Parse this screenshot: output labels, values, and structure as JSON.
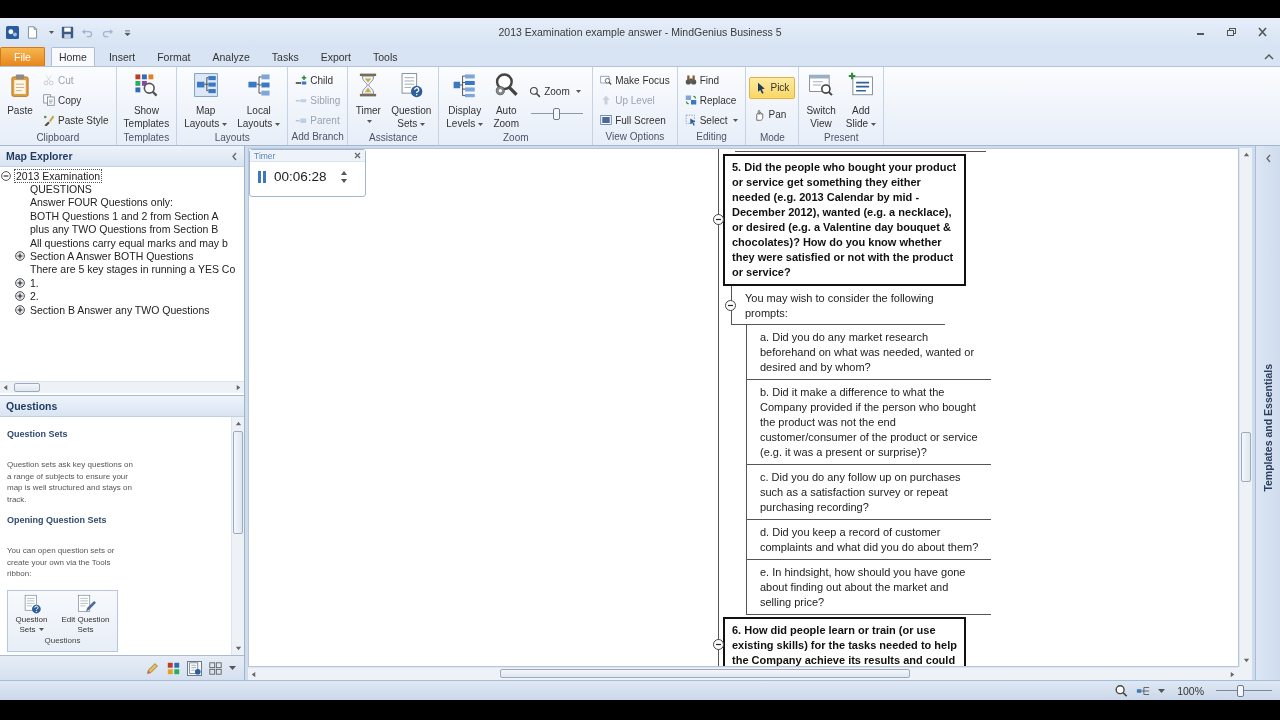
{
  "window": {
    "title": "2013 Examination example answer - MindGenius Business 5"
  },
  "quick_access": [
    {
      "kind": "new",
      "dropdown": true,
      "disabled": false
    },
    {
      "kind": "save",
      "dropdown": false,
      "disabled": false
    },
    {
      "kind": "undo",
      "dropdown": false,
      "disabled": true
    },
    {
      "kind": "redo",
      "dropdown": false,
      "disabled": true
    }
  ],
  "ribbon_tabs": [
    {
      "label": "File",
      "kind": "file",
      "selected": false
    },
    {
      "label": "Home",
      "kind": "tab",
      "selected": true
    },
    {
      "label": "Insert",
      "kind": "tab",
      "selected": false
    },
    {
      "label": "Format",
      "kind": "tab",
      "selected": false
    },
    {
      "label": "Analyze",
      "kind": "tab",
      "selected": false
    },
    {
      "label": "Tasks",
      "kind": "tab",
      "selected": false
    },
    {
      "label": "Export",
      "kind": "tab",
      "selected": false
    },
    {
      "label": "Tools",
      "kind": "tab",
      "selected": false
    }
  ],
  "ribbon_groups": [
    {
      "label": "Clipboard",
      "buttons": [
        {
          "kind": "large",
          "label": "Paste",
          "dropdown": false,
          "disabled": false
        },
        {
          "kind": "small",
          "label": "Cut",
          "dropdown": false,
          "disabled": true
        },
        {
          "kind": "small",
          "label": "Copy",
          "dropdown": false,
          "disabled": false
        },
        {
          "kind": "small",
          "label": "Paste Style",
          "dropdown": false,
          "disabled": false
        }
      ]
    },
    {
      "label": "Templates",
      "buttons": [
        {
          "kind": "large",
          "label": "Show Templates",
          "dropdown": false,
          "disabled": false
        }
      ]
    },
    {
      "label": "Layouts",
      "buttons": [
        {
          "kind": "large",
          "label": "Map Layouts",
          "dropdown": true,
          "disabled": false
        },
        {
          "kind": "large",
          "label": "Local Layouts",
          "dropdown": true,
          "disabled": false
        }
      ]
    },
    {
      "label": "Add Branch",
      "buttons": [
        {
          "kind": "small",
          "label": "Child",
          "dropdown": false,
          "disabled": false
        },
        {
          "kind": "small",
          "label": "Sibling",
          "dropdown": false,
          "disabled": true
        },
        {
          "kind": "small",
          "label": "Parent",
          "dropdown": false,
          "disabled": true
        }
      ]
    },
    {
      "label": "Assistance",
      "buttons": [
        {
          "kind": "large",
          "label": "Timer",
          "dropdown": true,
          "disabled": false
        },
        {
          "kind": "large",
          "label": "Question Sets",
          "dropdown": true,
          "disabled": false
        }
      ]
    },
    {
      "label": "Zoom",
      "buttons": [
        {
          "kind": "large",
          "label": "Display Levels",
          "dropdown": true,
          "disabled": false
        },
        {
          "kind": "large",
          "label": "Auto Zoom",
          "dropdown": false,
          "disabled": false
        },
        {
          "kind": "small",
          "label": "Zoom",
          "dropdown": true,
          "disabled": false
        },
        {
          "kind": "slider",
          "level": 0.5
        }
      ]
    },
    {
      "label": "View Options",
      "buttons": [
        {
          "kind": "small",
          "label": "Make Focus",
          "dropdown": false,
          "disabled": false
        },
        {
          "kind": "small",
          "label": "Up Level",
          "dropdown": false,
          "disabled": true
        },
        {
          "kind": "small",
          "label": "Full Screen",
          "dropdown": false,
          "disabled": false
        }
      ]
    },
    {
      "label": "Editing",
      "buttons": [
        {
          "kind": "small",
          "label": "Find",
          "dropdown": false,
          "disabled": false
        },
        {
          "kind": "small",
          "label": "Replace",
          "dropdown": false,
          "disabled": false
        },
        {
          "kind": "small",
          "label": "Select",
          "dropdown": true,
          "disabled": false
        }
      ]
    },
    {
      "label": "Mode",
      "buttons": [
        {
          "kind": "small",
          "label": "Pick",
          "dropdown": false,
          "disabled": false,
          "selected": true
        },
        {
          "kind": "small",
          "label": "Pan",
          "dropdown": false,
          "disabled": false,
          "selected": false
        }
      ]
    },
    {
      "label": "Present",
      "buttons": [
        {
          "kind": "large",
          "label": "Switch View",
          "dropdown": false,
          "disabled": false
        },
        {
          "kind": "large",
          "label": "Add Slide",
          "dropdown": true,
          "disabled": false
        }
      ]
    }
  ],
  "map_explorer": {
    "title": "Map Explorer",
    "tree": [
      {
        "text": "2013 Examination",
        "expanded": true,
        "selected": true,
        "children": [
          {
            "text": "QUESTIONS",
            "selected": false
          },
          {
            "text": "Answer FOUR Questions only:",
            "selected": false
          },
          {
            "text": "BOTH Questions 1 and 2 from Section A",
            "selected": false
          },
          {
            "text": "plus any TWO Questions from Section B",
            "selected": false
          },
          {
            "text": "All questions carry equal marks and may b",
            "selected": false
          },
          {
            "text": "Section A Answer BOTH Questions",
            "expanded": false,
            "selected": false
          },
          {
            "text": "There are 5 key stages in running a YES Co",
            "selected": false
          },
          {
            "text": "1.",
            "expanded": false,
            "selected": false
          },
          {
            "text": "2.",
            "expanded": false,
            "selected": false
          },
          {
            "text": "Section B Answer any TWO Questions",
            "expanded": false,
            "selected": false
          }
        ]
      }
    ]
  },
  "questions_pane": {
    "title": "Questions",
    "sections": [
      {
        "heading": "Question Sets",
        "text": "Question sets ask key questions on a range of subjects to ensure your map is well structured and stays on track."
      },
      {
        "heading": "Opening Question Sets",
        "text": "You can open question sets or create your own via the Tools ribbon:"
      }
    ],
    "ribbon_preview": {
      "buttons": [
        {
          "label": "Question Sets",
          "dropdown": true
        },
        {
          "label": "Edit Question Sets",
          "dropdown": false
        }
      ],
      "group_label": "Questions"
    }
  },
  "explorer_toolbar": [
    {
      "selected": false
    },
    {
      "selected": false
    },
    {
      "selected": true
    },
    {
      "selected": false
    }
  ],
  "timer": {
    "title": "Timer",
    "time": "00:06:28"
  },
  "map_canvas": {
    "nodes": [
      {
        "text": "5. Did the people who bought your product or service get something they either needed (e.g. 2013 Calendar by mid - December 2012), wanted (e.g. a necklace), or desired (e.g. a Valentine day bouquet & chocolates)? How do you know whether they were satisfied or not with the product or service?",
        "expanded": true,
        "children": [
          {
            "text": "You may wish to consider the following prompts:",
            "expanded": true,
            "children": [
              {
                "text": "a. Did you do any market research beforehand on what was needed, wanted or desired and by whom?"
              },
              {
                "text": "b. Did it make a difference to what the Company provided if the person who bought the product was not the end customer/consumer of the product or service (e.g. it was a present or surprise)?"
              },
              {
                "text": "c. Did you do any follow up on purchases such as a satisfaction survey or repeat purchasing recording?"
              },
              {
                "text": "d. Did you keep a record of customer complaints and what did you do about them?"
              },
              {
                "text": "e. In hindsight, how should you have gone about finding out about the market and selling price?"
              }
            ]
          }
        ]
      },
      {
        "text": "6. How did people learn or train (or use existing skills) for the tasks needed to help the Company achieve its results and could",
        "expanded": true
      }
    ]
  },
  "side_panel": {
    "title": "Templates and Essentials"
  },
  "status_bar": {
    "zoom_text": "100%",
    "zoom_slider": {
      "level": 0.45
    }
  }
}
